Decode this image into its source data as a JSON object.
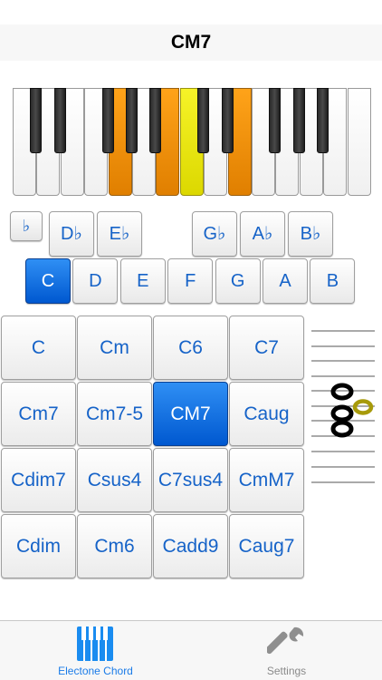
{
  "navbar": {
    "title": "CM7"
  },
  "keyboard": {
    "white_keys": [
      "normal",
      "normal",
      "normal",
      "normal",
      "orange",
      "normal",
      "orange",
      "yellow",
      "normal",
      "orange",
      "normal",
      "normal",
      "normal",
      "normal",
      "normal"
    ],
    "highlight_colors": {
      "orange": "#f08d00",
      "yellow": "#ebe600"
    }
  },
  "flat_toggle": {
    "label": "♭"
  },
  "accidentals": [
    "D♭",
    "E♭",
    "G♭",
    "A♭",
    "B♭"
  ],
  "roots": {
    "items": [
      "C",
      "D",
      "E",
      "F",
      "G",
      "A",
      "B"
    ],
    "selected": "C"
  },
  "chords": {
    "rows": [
      [
        "C",
        "Cm",
        "C6",
        "C7"
      ],
      [
        "Cm7",
        "Cm7-5",
        "CM7",
        "Caug"
      ],
      [
        "Cdim7",
        "Csus4",
        "C7sus4",
        "CmM7"
      ],
      [
        "Cdim",
        "Cm6",
        "Cadd9",
        "Caug7"
      ]
    ],
    "selected": "CM7"
  },
  "colors": {
    "accent": "#1663c8",
    "selected": "#0a6ae0"
  },
  "tabbar": {
    "tabs": [
      {
        "label": "Electone Chord",
        "icon": "keyboard-icon",
        "active": true
      },
      {
        "label": "Settings",
        "icon": "wrench-icon",
        "active": false
      }
    ]
  }
}
